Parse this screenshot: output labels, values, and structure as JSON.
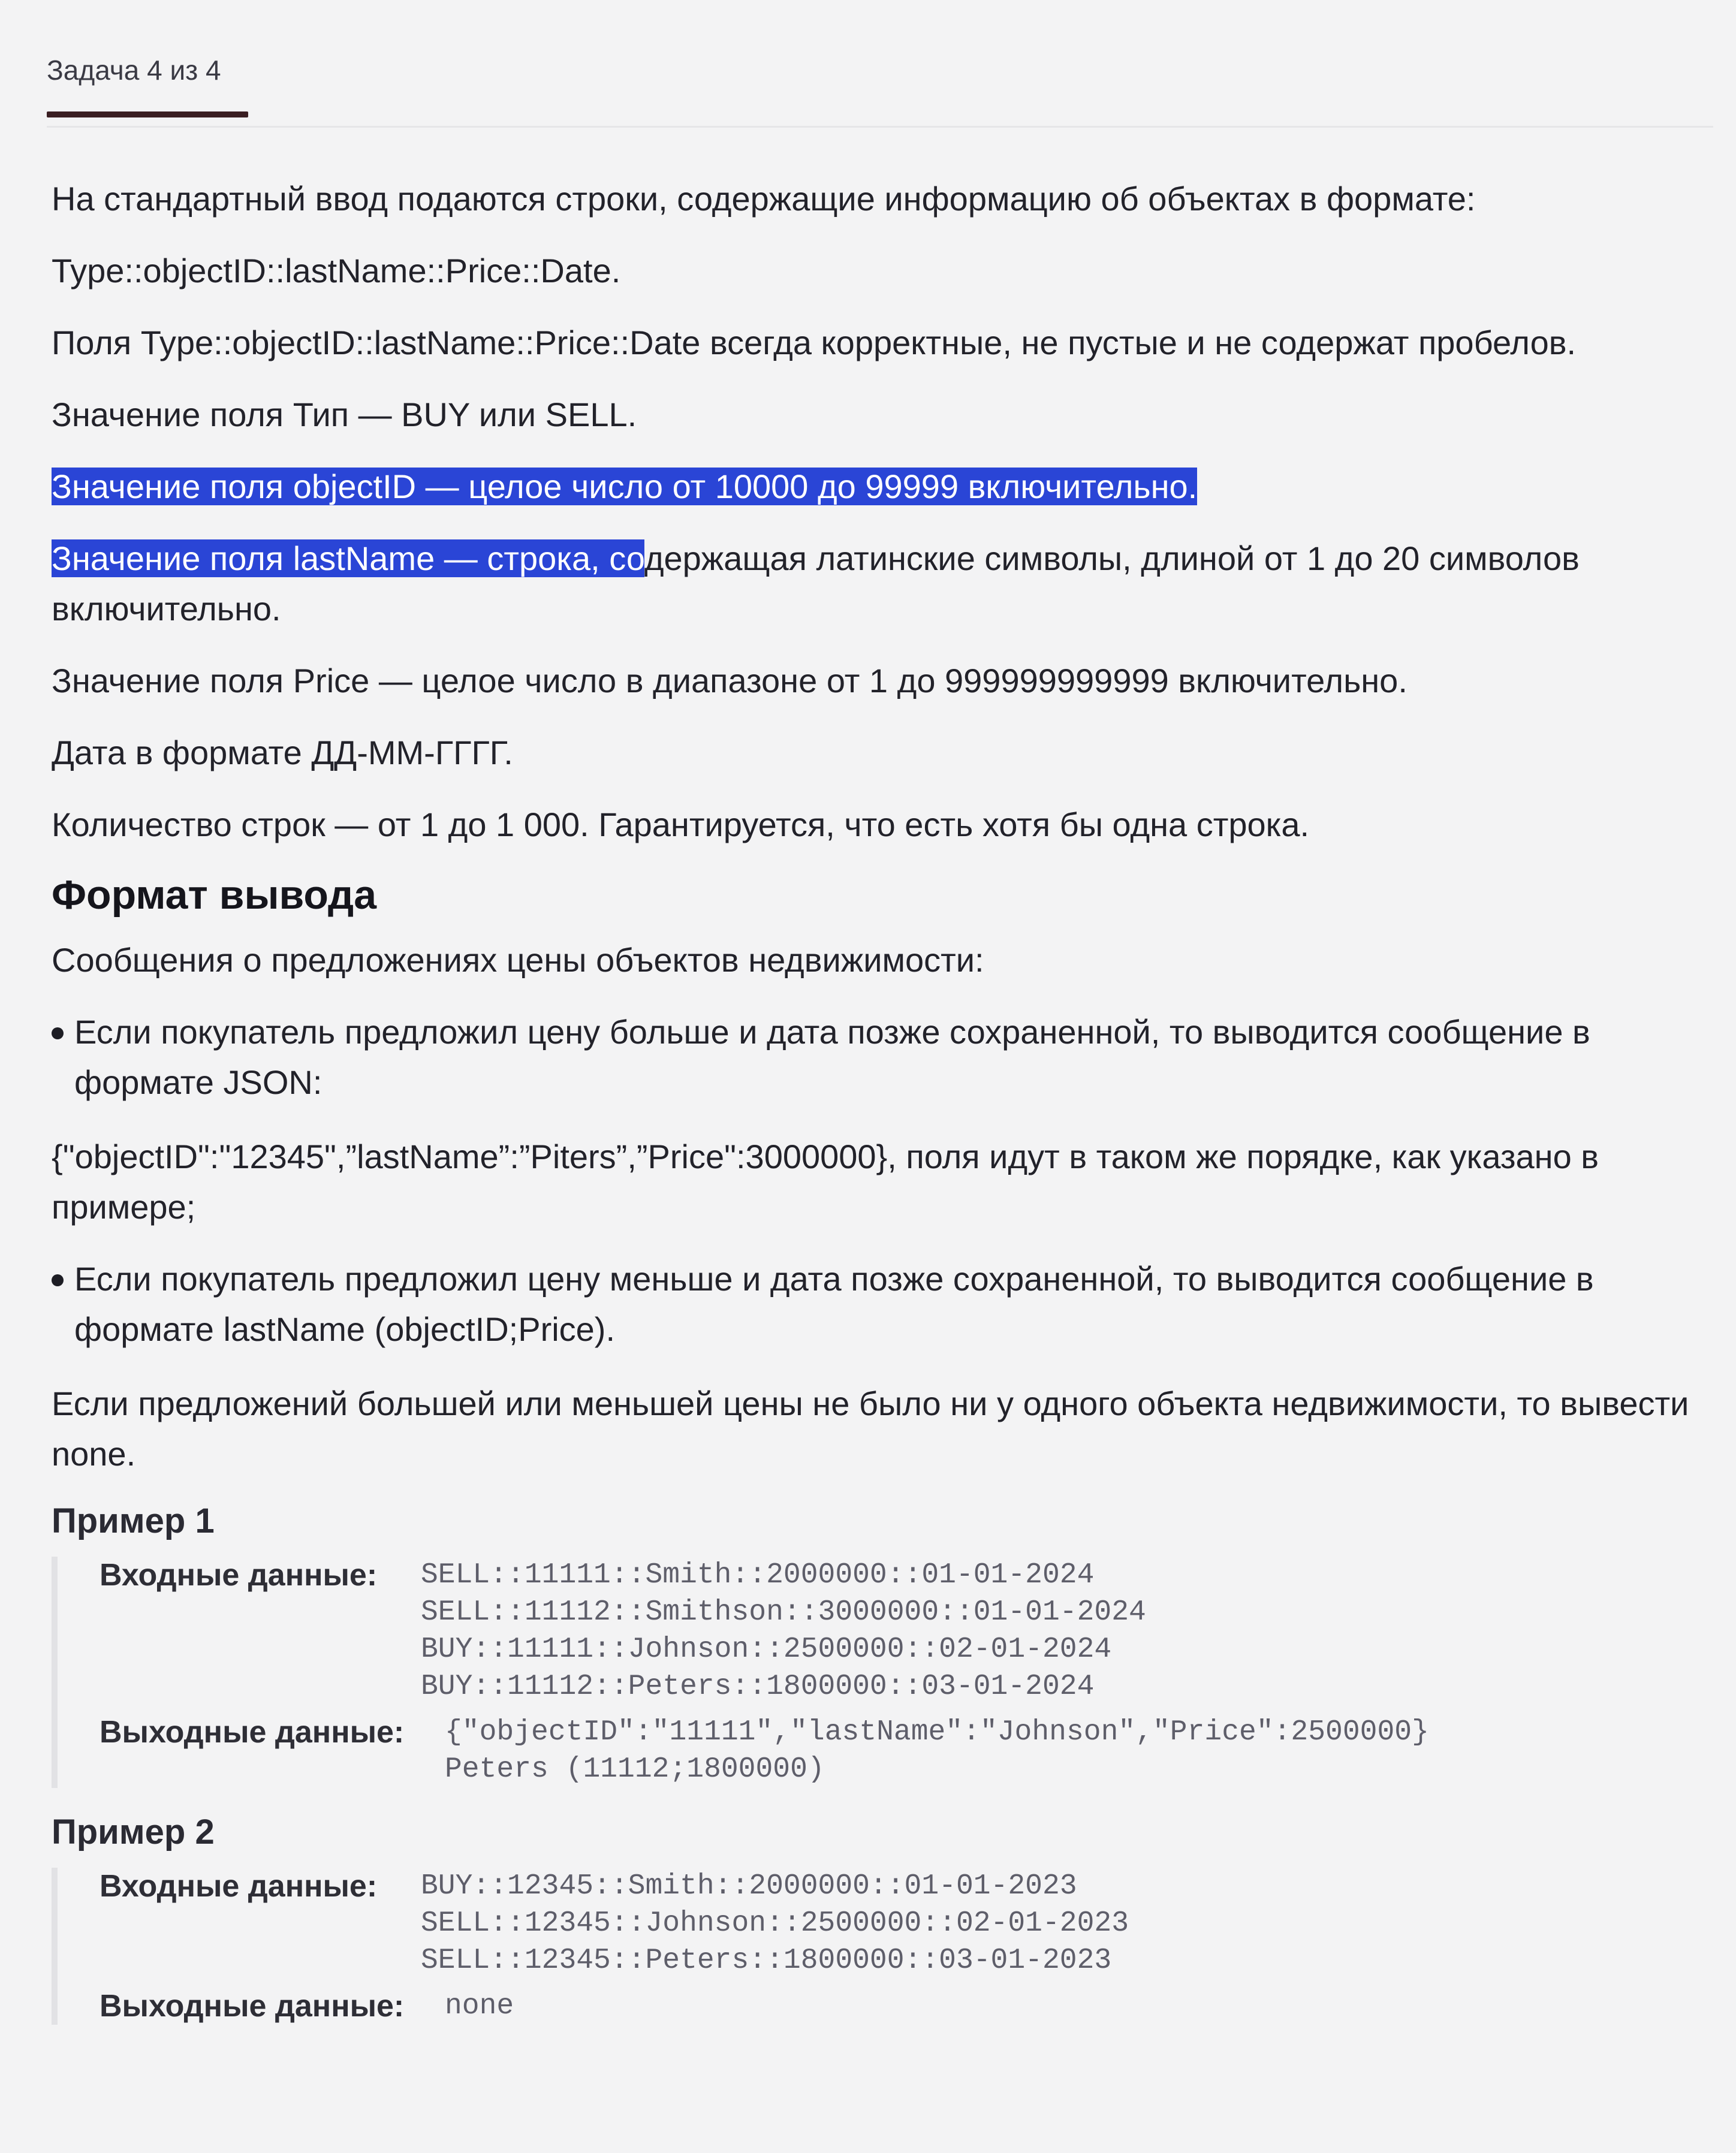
{
  "header": {
    "task_tab": "Задача 4 из 4"
  },
  "statement": {
    "p1": "На стандартный ввод подаются строки, содержащие информацию об объектах в формате:",
    "p2": "Type::objectID::lastName::Price::Date.",
    "p3": "Поля Type::objectID::lastName::Price::Date всегда корректные, не пустые и не содержат пробелов.",
    "p4": "Значение поля Тип — BUY или SELL.",
    "p5": "Значение поля objectID — целое число от 10000 до 99999 включительно.",
    "p6_selected": "Значение поля lastName — строка, со",
    "p6_rest": "держащая латинские символы, длиной от 1 до 20 символов включительно.",
    "p7": "Значение поля Price — целое число в диапазоне от 1 до 999999999999 включительно.",
    "p8": "Дата в формате ДД-ММ-ГГГГ.",
    "p9": "Количество строк — от 1 до 1 000. Гарантируется, что есть хотя бы одна строка."
  },
  "output_format": {
    "title": "Формат вывода",
    "intro": "Сообщения о предложениях цены объектов недвижимости:",
    "bullet1": "Если покупатель предложил цену больше и дата позже сохраненной, то выводится сообщение в формате JSON:",
    "json_example": "{\"objectID\":\"12345\",”lastName”:”Piters”,”Price\":3000000}, поля идут в таком же порядке, как указано в примере;",
    "bullet2": "Если покупатель предложил цену меньше и дата позже сохраненной, то выводится сообщение в формате lastName (objectID;Price).",
    "none_note": "Если предложений большей или меньшей цены не было ни у одного объекта недвижимости, то вывести none."
  },
  "examples": [
    {
      "title": "Пример 1",
      "input_label": "Входные данные:",
      "input_lines": [
        "SELL::11111::Smith::2000000::01-01-2024",
        "SELL::11112::Smithson::3000000::01-01-2024",
        "BUY::11111::Johnson::2500000::02-01-2024",
        "BUY::11112::Peters::1800000::03-01-2024"
      ],
      "output_label": "Выходные данные:",
      "output_lines": [
        "{\"objectID\":\"11111\",\"lastName\":\"Johnson\",\"Price\":2500000}",
        "Peters (11112;1800000)"
      ]
    },
    {
      "title": "Пример 2",
      "input_label": "Входные данные:",
      "input_lines": [
        "BUY::12345::Smith::2000000::01-01-2023",
        "SELL::12345::Johnson::2500000::02-01-2023",
        "SELL::12345::Peters::1800000::03-01-2023"
      ],
      "output_label": "Выходные данные:",
      "output_lines": [
        "none"
      ]
    }
  ],
  "colors": {
    "selection": "#2a45d6",
    "tab_underline": "#3a1e22",
    "background": "#f3f3f4"
  }
}
